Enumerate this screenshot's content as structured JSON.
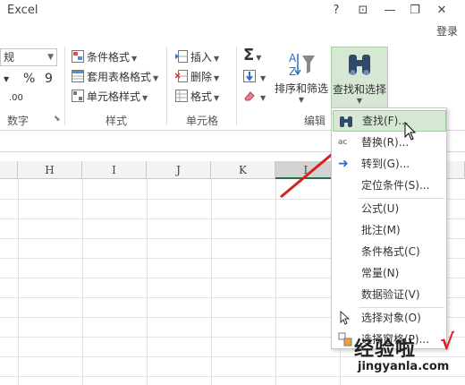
{
  "titlebar": {
    "title": "Excel",
    "help_label": "?",
    "ribbon_toggle_label": "⊡",
    "minimize_label": "—",
    "restore_label": "❐",
    "close_label": "✕",
    "login_label": "登录"
  },
  "ribbon": {
    "number": {
      "format_value": "规",
      "percent_label": "%",
      "comma_label": "9",
      "decimal_label": ".00",
      "group_label": "数字"
    },
    "styles": {
      "conditional_formatting": "条件格式",
      "format_as_table": "套用表格格式",
      "cell_styles": "单元格样式",
      "group_label": "样式"
    },
    "cells": {
      "insert": "插入",
      "delete": "删除",
      "format": "格式",
      "group_label": "单元格"
    },
    "editing": {
      "sort_filter": "排序和筛选",
      "find_select": "查找和选择",
      "group_label": "编辑"
    }
  },
  "sheet": {
    "columns": [
      "H",
      "I",
      "J",
      "K",
      "L"
    ]
  },
  "menu": {
    "items": [
      {
        "label": "查找(F)...",
        "icon": "binoculars-icon"
      },
      {
        "label": "替换(R)...",
        "icon": "replace-icon"
      },
      {
        "label": "转到(G)...",
        "icon": "arrow-right-icon"
      },
      {
        "label": "定位条件(S)...",
        "icon": ""
      },
      {
        "label": "公式(U)",
        "icon": ""
      },
      {
        "label": "批注(M)",
        "icon": ""
      },
      {
        "label": "条件格式(C)",
        "icon": ""
      },
      {
        "label": "常量(N)",
        "icon": ""
      },
      {
        "label": "数据验证(V)",
        "icon": ""
      },
      {
        "label": "选择对象(O)",
        "icon": "select-objects-icon"
      },
      {
        "label": "选择窗格(P)...",
        "icon": "selection-pane-icon"
      }
    ]
  },
  "watermark": {
    "cn": "经验啦",
    "url": "jingyanla.com",
    "check": "√"
  },
  "colors": {
    "highlight": "#d6e8d4",
    "accent_green": "#217346",
    "arrow_red": "#d62020"
  }
}
